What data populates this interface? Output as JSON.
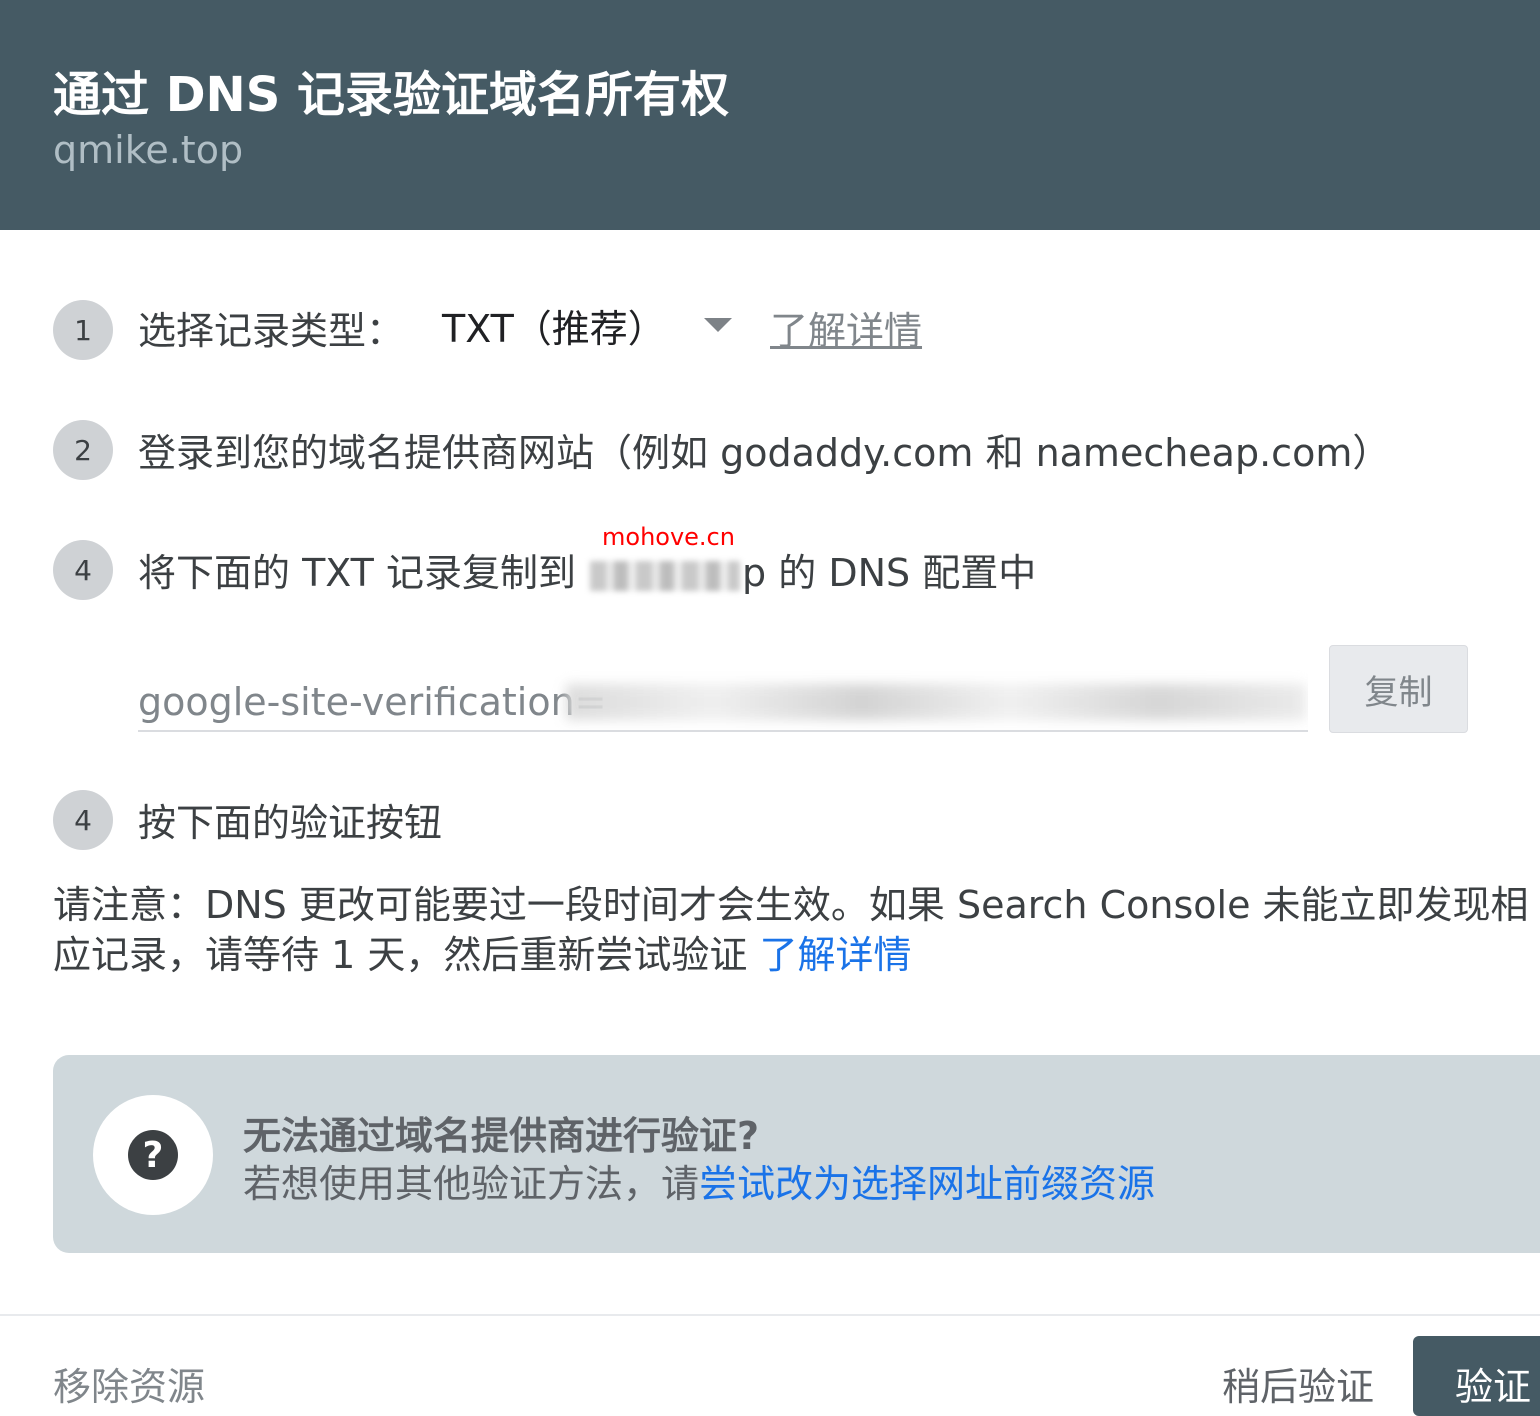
{
  "header": {
    "title": "通过 DNS 记录验证域名所有权",
    "subtitle": "qmike.top"
  },
  "steps": [
    {
      "number": "1",
      "label": "选择记录类型："
    },
    {
      "number": "2",
      "label": "登录到您的域名提供商网站（例如 godaddy.com 和 namecheap.com）"
    },
    {
      "number": "4",
      "label_before": "将下面的 TXT 记录复制到",
      "label_after": "p 的 DNS 配置中"
    },
    {
      "number": "4",
      "label": "按下面的验证按钮"
    }
  ],
  "record_type": {
    "selected": "TXT（推荐）",
    "learn_more": "了解详情"
  },
  "watermark": "mohove.cn",
  "txt_record": {
    "prefix": "google-site-verification=",
    "copy_label": "复制"
  },
  "note": {
    "text": "请注意：DNS 更改可能要过一段时间才会生效。如果 Search Console 未能立即发现相应记录，请等待 1 天，然后重新尝试验证",
    "link": "了解详情"
  },
  "help": {
    "icon": "question-mark-icon",
    "title": "无法通过域名提供商进行验证?",
    "body": "若想使用其他验证方法，请",
    "link": "尝试改为选择网址前缀资源"
  },
  "footer": {
    "remove": "移除资源",
    "later": "稍后验证",
    "verify": "验证"
  }
}
